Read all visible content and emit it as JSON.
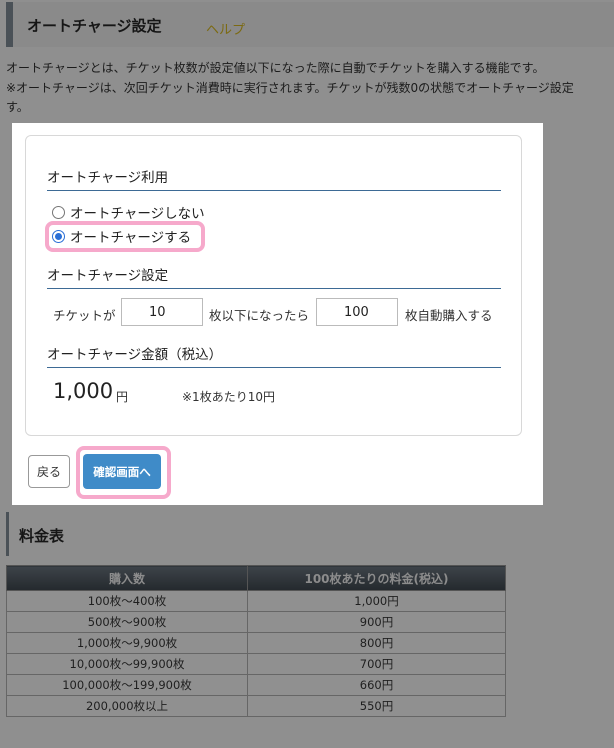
{
  "header": {
    "title": "オートチャージ設定",
    "help_link": "ヘルプ"
  },
  "description": {
    "line1": "オートチャージとは、チケット枚数が設定値以下になった際に自動でチケットを購入する機能です。",
    "line2": "※オートチャージは、次回チケット消費時に実行されます。チケットが残数0の状態でオートチャージ設定",
    "line3": "す。"
  },
  "modal": {
    "usage_section": {
      "title": "オートチャージ利用",
      "options": [
        {
          "label": "オートチャージしない",
          "checked": false
        },
        {
          "label": "オートチャージする",
          "checked": true
        }
      ]
    },
    "settings_section": {
      "title": "オートチャージ設定",
      "prefix": "チケットが",
      "threshold_value": "10",
      "middle": "枚以下になったら",
      "purchase_value": "100",
      "suffix": "枚自動購入する"
    },
    "amount_section": {
      "title": "オートチャージ金額（税込）",
      "amount": "1,000",
      "unit": "円",
      "note": "※1枚あたり10円"
    },
    "buttons": {
      "back": "戻る",
      "confirm": "確認画面へ"
    }
  },
  "price_table": {
    "title": "料金表",
    "headers": [
      "購入数",
      "100枚あたりの料金(税込)"
    ],
    "rows": [
      [
        "100枚～400枚",
        "1,000円"
      ],
      [
        "500枚～900枚",
        "900円"
      ],
      [
        "1,000枚～9,900枚",
        "800円"
      ],
      [
        "10,000枚～99,900枚",
        "700円"
      ],
      [
        "100,000枚～199,900枚",
        "660円"
      ],
      [
        "200,000枚以上",
        "550円"
      ]
    ]
  },
  "colors": {
    "overlay": "#8f8f8f",
    "accent_blue": "#3f8bc8",
    "highlight_pink": "#f6a9cb",
    "section_underline": "#3d6a95"
  }
}
